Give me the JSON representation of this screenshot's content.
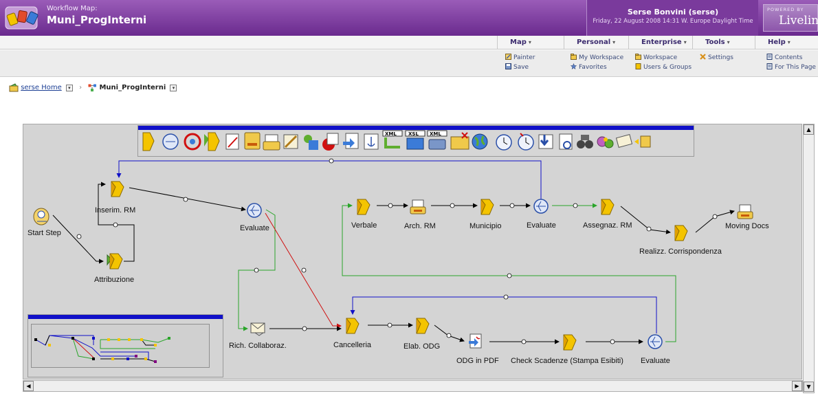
{
  "header": {
    "map_label": "Workflow Map:",
    "map_title": "Muni_ProgInterni",
    "user_name": "Serse Bonvini (serse)",
    "user_date": "Friday, 22 August 2008 14:31 W. Europe Daylight Time",
    "powered_by": "POWERED BY",
    "brand": "Livelink"
  },
  "menus": [
    {
      "label": "Map",
      "items": [
        "Painter",
        "Save"
      ]
    },
    {
      "label": "Personal",
      "items": [
        "My Workspace",
        "Favorites"
      ]
    },
    {
      "label": "Enterprise",
      "items": [
        "Workspace",
        "Users & Groups"
      ]
    },
    {
      "label": "Tools",
      "items": [
        "Settings"
      ]
    },
    {
      "label": "Help",
      "items": [
        "Contents",
        "For This Page"
      ]
    }
  ],
  "breadcrumb": {
    "home": "serse Home",
    "current": "Muni_ProgInterni"
  },
  "palette_icons": [
    "start-step-icon",
    "evaluate-icon",
    "loop-icon",
    "user-step-icon",
    "form-icon",
    "print-icon",
    "print-doc-icon",
    "sign-icon",
    "subflow-icon",
    "distribute-icon",
    "pdf-icon",
    "anchor-icon",
    "xml-icon",
    "xsl-icon",
    "xml-export-icon",
    "delete-folder-icon",
    "web-icon",
    "timer-icon",
    "timer-alert-icon",
    "download-icon",
    "refresh-icon",
    "search-icon",
    "process-icon",
    "collaborate-icon",
    "folder-user-icon"
  ],
  "workflow": {
    "nodes": [
      {
        "label": "Start Step",
        "icon": "start-step-icon"
      },
      {
        "label": "Inserim. RM",
        "icon": "user-step-icon"
      },
      {
        "label": "Attribuzione",
        "icon": "user-group-step-icon"
      },
      {
        "label": "Evaluate",
        "icon": "evaluate-icon"
      },
      {
        "label": "Verbale",
        "icon": "user-step-icon"
      },
      {
        "label": "Arch. RM",
        "icon": "print-icon"
      },
      {
        "label": "Municipio",
        "icon": "user-step-icon"
      },
      {
        "label": "Evaluate",
        "icon": "evaluate-icon"
      },
      {
        "label": "Assegnaz. RM",
        "icon": "user-step-icon"
      },
      {
        "label": "Realizz. Corrispondenza",
        "icon": "user-step-icon"
      },
      {
        "label": "Moving Docs",
        "icon": "print-icon"
      },
      {
        "label": "Rich. Collaboraz.",
        "icon": "collaborate-icon"
      },
      {
        "label": "Cancelleria",
        "icon": "user-step-icon"
      },
      {
        "label": "Elab. ODG",
        "icon": "user-step-icon"
      },
      {
        "label": "ODG in PDF",
        "icon": "pdf-icon"
      },
      {
        "label": "Check Scadenze (Stampa Esibiti)",
        "icon": "user-step-icon"
      },
      {
        "label": "Evaluate",
        "icon": "evaluate-icon"
      }
    ]
  },
  "colors": {
    "banner": "#7a3a9c",
    "link_blue": "#1010c8",
    "path_green": "#2aa52a",
    "path_red": "#d01010"
  }
}
